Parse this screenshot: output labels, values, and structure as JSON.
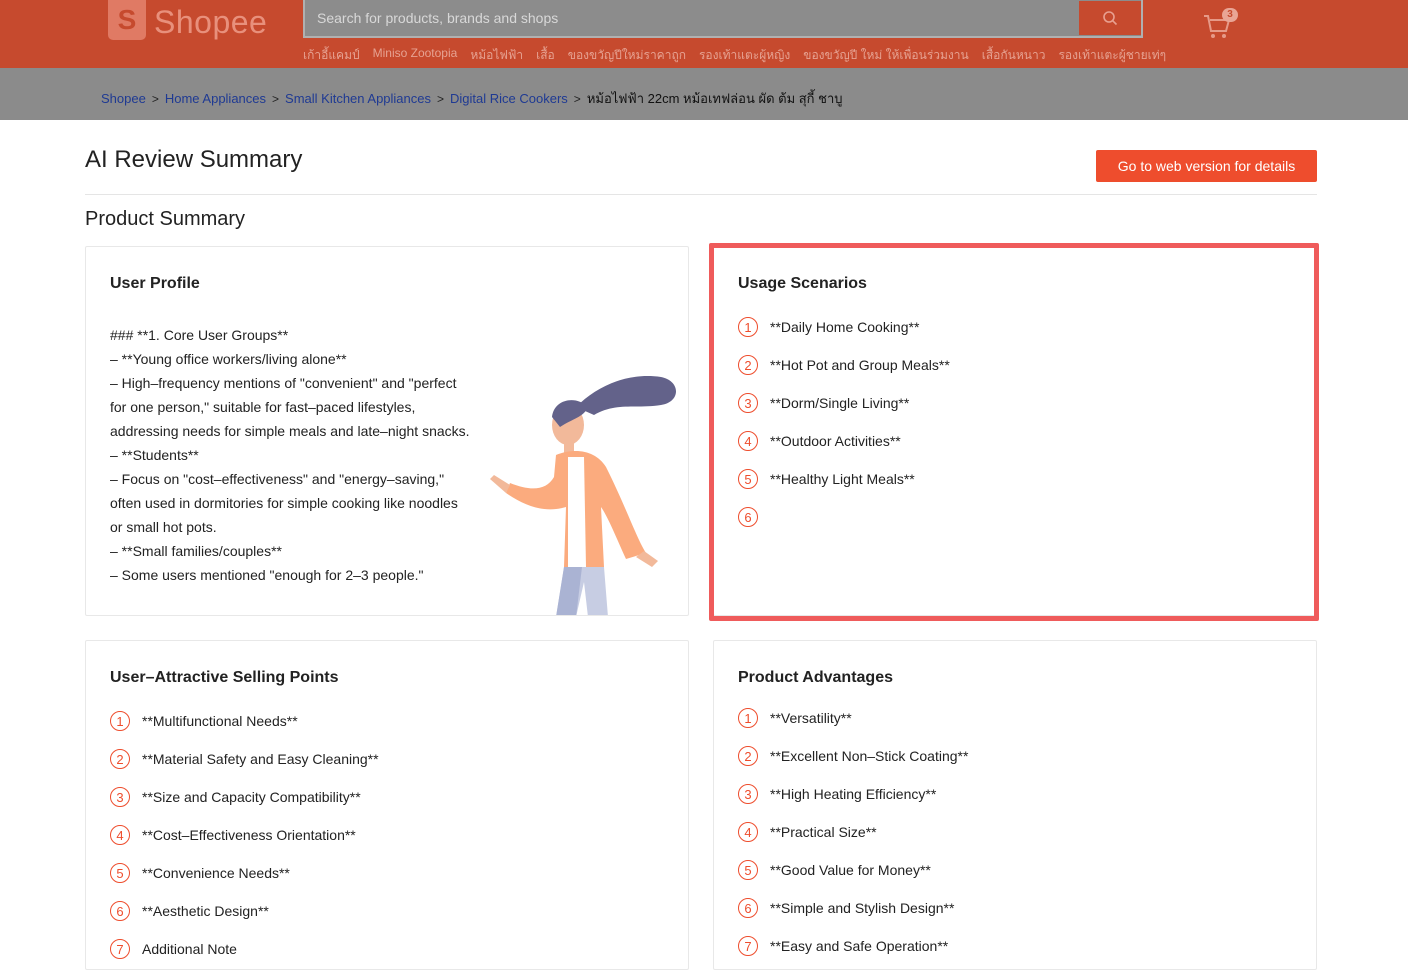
{
  "header": {
    "logo_letter": "S",
    "logo_text": "Shopee",
    "search_placeholder": "Search for products, brands and shops",
    "cart_count": "3",
    "suggestions": [
      "เก้าอี้แคมป์",
      "Miniso Zootopia",
      "หม้อไฟฟ้า",
      "เสื้อ",
      "ของขวัญปีใหม่ราคาถูก",
      "รองเท้าแตะผู้หญิง",
      "ของขวัญปี ใหม่ ให้เพื่อนร่วมงาน",
      "เสื้อกันหนาว",
      "รองเท้าแตะผู้ชายเท่ๆ"
    ]
  },
  "breadcrumb": {
    "items": [
      "Shopee",
      "Home Appliances",
      "Small Kitchen Appliances",
      "Digital Rice Cookers"
    ],
    "current": "หม้อไฟฟ้า 22cm หม้อเทฟล่อน ผัด ต้ม สุกี้ ชาบู"
  },
  "page": {
    "title": "AI Review Summary",
    "web_button": "Go to web version for details",
    "section_title": "Product Summary"
  },
  "user_profile": {
    "title": "User Profile",
    "lines": [
      "### **1. Core User Groups**",
      "– **Young office workers/living alone**",
      "– High–frequency mentions of \"convenient\" and \"perfect for one person,\" suitable for fast–paced lifestyles, addressing needs for simple meals and late–night snacks.",
      "– **Students**",
      "– Focus on \"cost–effectiveness\" and \"energy–saving,\" often used in dormitories for simple cooking like noodles or small hot pots.",
      "– **Small families/couples**",
      "– Some users mentioned \"enough for 2–3 people.\""
    ]
  },
  "usage_scenarios": {
    "title": "Usage Scenarios",
    "items": [
      "**Daily Home Cooking**",
      "**Hot Pot and Group Meals**",
      "**Dorm/Single Living**",
      "**Outdoor Activities**",
      "**Healthy Light Meals**",
      ""
    ]
  },
  "selling_points": {
    "title": "User–Attractive Selling Points",
    "items": [
      "**Multifunctional Needs**",
      "**Material Safety and Easy Cleaning**",
      "**Size and Capacity Compatibility**",
      "**Cost–Effectiveness Orientation**",
      "**Convenience Needs**",
      "**Aesthetic Design**",
      "Additional Note"
    ]
  },
  "advantages": {
    "title": "Product Advantages",
    "items": [
      "**Versatility**",
      "**Excellent Non–Stick Coating**",
      "**High Heating Efficiency**",
      "**Practical Size**",
      "**Good Value for Money**",
      "**Simple and Stylish Design**",
      "**Easy and Safe Operation**"
    ]
  },
  "colors": {
    "header_bg": "#c64a2e",
    "accent": "#ee4d2d",
    "highlight_border": "#ef5b5b",
    "link": "#1f3a93"
  }
}
